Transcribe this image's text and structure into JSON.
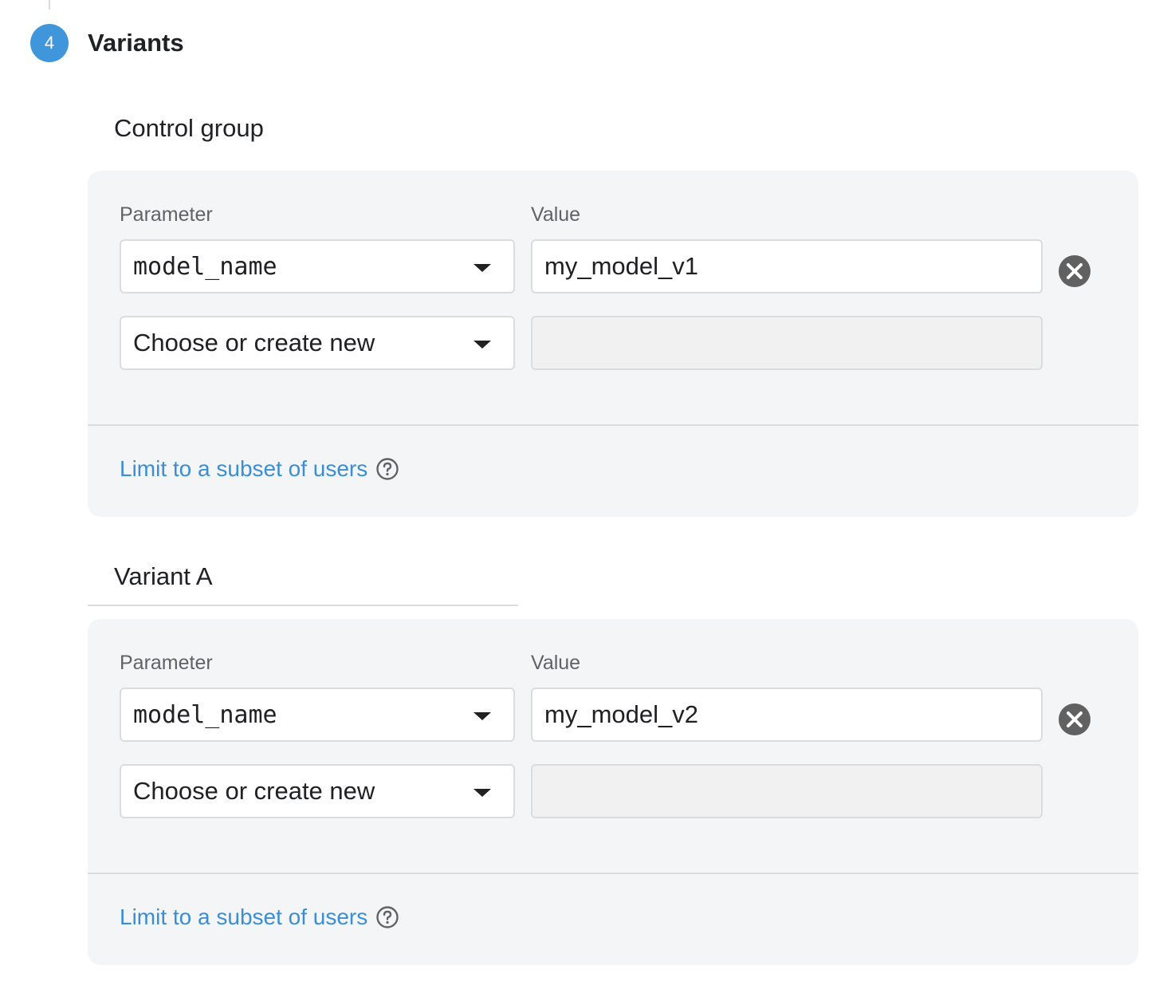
{
  "step": {
    "number": "4",
    "title": "Variants"
  },
  "groups": [
    {
      "title": "Control group",
      "parameter_label": "Parameter",
      "value_label": "Value",
      "rows": [
        {
          "parameter": "model_name",
          "value": "my_model_v1"
        },
        {
          "parameter": "Choose or create new",
          "value": ""
        }
      ],
      "limit_link": "Limit to a subset of users"
    },
    {
      "title": "Variant A",
      "parameter_label": "Parameter",
      "value_label": "Value",
      "rows": [
        {
          "parameter": "model_name",
          "value": "my_model_v2"
        },
        {
          "parameter": "Choose or create new",
          "value": ""
        }
      ],
      "limit_link": "Limit to a subset of users"
    }
  ],
  "icons": {
    "remove": "close-circle-icon",
    "help": "help-circle-icon",
    "dropdown": "caret-down-icon"
  },
  "colors": {
    "accent": "#4096db",
    "link": "#3a8ed6",
    "card_bg": "#f4f5f7",
    "remove_icon": "#616161"
  }
}
